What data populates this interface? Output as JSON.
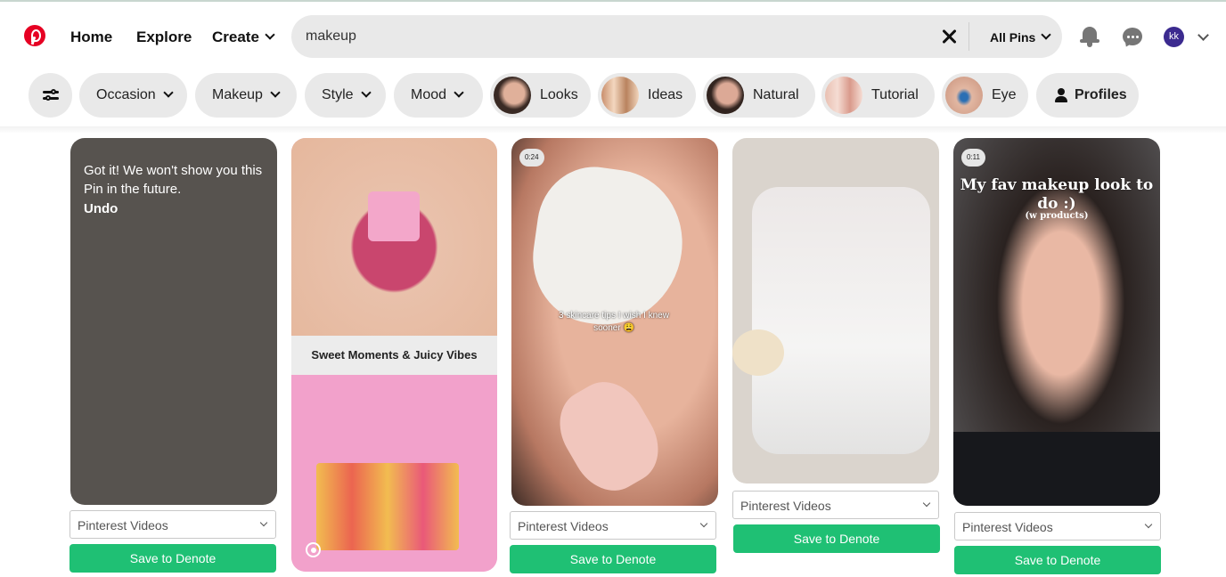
{
  "header": {
    "nav": {
      "home": "Home",
      "explore": "Explore",
      "create": "Create"
    },
    "search": {
      "query": "makeup",
      "scope": "All Pins"
    },
    "account": {
      "initials": "kk"
    }
  },
  "filters": {
    "dropdowns": [
      "Occasion",
      "Makeup",
      "Style",
      "Mood"
    ],
    "suggestions": [
      "Looks",
      "Ideas",
      "Natural",
      "Tutorial",
      "Eye"
    ],
    "profiles": "Profiles"
  },
  "pins": [
    {
      "message": "Got it! We won't show you this Pin in the future.",
      "undo": "Undo",
      "board": "Pinterest Videos",
      "save": "Save to Denote"
    },
    {
      "caption": "Sweet Moments & Juicy Vibes"
    },
    {
      "duration": "0:24",
      "caption": "3 skincare tips I wish I knew sooner 😩",
      "board": "Pinterest Videos",
      "save": "Save to Denote"
    },
    {
      "board": "Pinterest Videos",
      "save": "Save to Denote"
    },
    {
      "duration": "0:11",
      "caption": "My fav makeup look to do :)",
      "subcaption": "(w products)",
      "board": "Pinterest Videos",
      "save": "Save to Denote"
    }
  ],
  "colors": {
    "brand": "#e60023",
    "save_button": "#1fc074",
    "chip_bg": "#e9e9e9",
    "avatar": "#3b2a8f"
  },
  "icons": [
    "pinterest-logo-icon",
    "chevron-down-icon",
    "close-icon",
    "bell-icon",
    "messages-icon",
    "sliders-icon",
    "person-icon",
    "target-icon"
  ]
}
